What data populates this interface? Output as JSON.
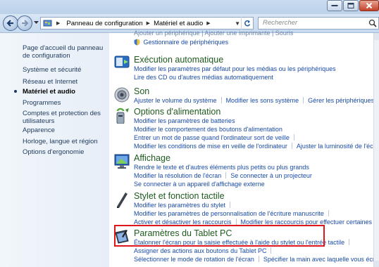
{
  "address_bar": {
    "crumbs": [
      "Panneau de configuration",
      "Matériel et audio"
    ]
  },
  "search": {
    "placeholder": "Rechercher"
  },
  "left_pane": {
    "links": [
      "Page d'accueil du panneau de configuration",
      "Système et sécurité",
      "Réseau et Internet",
      "Matériel et audio",
      "Programmes",
      "Comptes et protection des utilisateurs",
      "Apparence",
      "Horloge, langue et région",
      "Options d'ergonomie"
    ]
  },
  "categories": {
    "devices_partial": {
      "partial_line": "Ajouter un périphérique | Ajouter une imprimante | Souris",
      "links": [
        "Gestionnaire de périphériques"
      ]
    },
    "autoplay": {
      "title": "Exécution automatique",
      "links": [
        "Modifier les paramètres par défaut pour les médias ou les périphériques",
        "Lire des CD ou d'autres médias automatiquement"
      ]
    },
    "sound": {
      "title": "Son",
      "links": [
        "Ajuster le volume du système",
        "Modifier les sons système",
        "Gérer les périphériques audio"
      ]
    },
    "power": {
      "title": "Options d'alimentation",
      "links": [
        "Modifier les paramètres de batteries",
        "Modifier le comportement des boutons d'alimentation",
        "Entrer un mot de passe quand l'ordinateur sort de veille",
        "Modifier les conditions de mise en veille de l'ordinateur",
        "Ajuster la luminosité de l'écran"
      ]
    },
    "display": {
      "title": "Affichage",
      "links": [
        "Rendre le texte et d'autres éléments plus petits ou plus grands",
        "Modifier la résolution de l'écran",
        "Se connecter à un projecteur",
        "Se connecter à un appareil d'affichage externe"
      ]
    },
    "pen_touch": {
      "title": "Stylet et fonction tactile",
      "links": [
        "Modifier les paramètres du stylet",
        "Modifier les paramètres de personnalisation de l'écriture manuscrite",
        "Activer et désactiver les raccourcis",
        "Modifier les raccourcis pour effectuer certaines tâches"
      ]
    },
    "tablet": {
      "title": "Paramètres du Tablet PC",
      "links": [
        "Étalonner l'écran pour la saisie effectuée à l'aide du stylet ou l'entrée tactile",
        "Assigner des actions aux boutons du Tablet PC",
        "Sélectionner le mode de rotation de l'écran",
        "Spécifier la main avec laquelle vous écrivez"
      ]
    }
  },
  "colors": {
    "link": "#1a4ba8",
    "category_title": "#1e5a1e",
    "highlight_box": "#e0161d"
  }
}
